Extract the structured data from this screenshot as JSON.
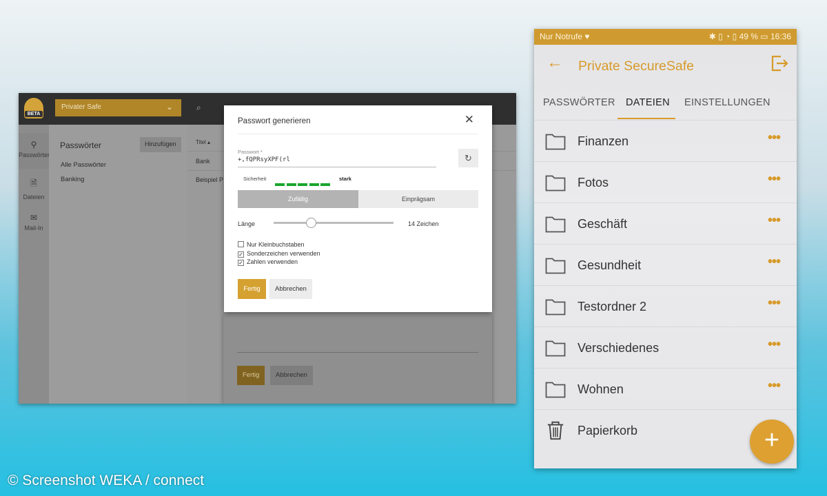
{
  "desktop": {
    "logo_text": "BETA",
    "safe_select": "Privater Safe",
    "rail": [
      {
        "label": "Passwörter",
        "icon": "key-icon"
      },
      {
        "label": "Dateien",
        "icon": "file-icon"
      },
      {
        "label": "Mail-In",
        "icon": "mail-icon"
      }
    ],
    "list": {
      "title": "Passwörter",
      "add_label": "Hinzufügen",
      "items": [
        "Alle Passwörter",
        "Banking"
      ]
    },
    "table": {
      "header": "Titel ▴",
      "rows": [
        "Bank",
        "Beispiel P"
      ]
    },
    "bg_dialog": {
      "ok_label": "Fertig",
      "cancel_label": "Abbrechen"
    }
  },
  "generator": {
    "title": "Passwort generieren",
    "password_label": "Passwort *",
    "password_value": "+,fQPRsyXPF(rl",
    "security_label": "Sicherheit",
    "security_value": "stark",
    "strength_segments_filled": 5,
    "modes": {
      "selected": "Zufällig",
      "other": "Einprägsam"
    },
    "length_label": "Länge",
    "length_value": "14 Zeichen",
    "length_fraction": 0.31,
    "options": [
      {
        "label": "Nur Kleinbuchstaben",
        "checked": false
      },
      {
        "label": "Sonderzeichen verwenden",
        "checked": true
      },
      {
        "label": "Zahlen verwenden",
        "checked": true
      }
    ],
    "ok_label": "Fertig",
    "cancel_label": "Abbrechen"
  },
  "phone": {
    "status_left": "Nur Notrufe ♥",
    "status_right": "✱ ▯ ◔ ▯ 49 % ▭ 16:36",
    "app_title": "Private SecureSafe",
    "tabs": [
      "PASSWÖRTER",
      "DATEIEN",
      "EINSTELLUNGEN"
    ],
    "active_tab": "DATEIEN",
    "folders": [
      "Finanzen",
      "Fotos",
      "Geschäft",
      "Gesundheit",
      "Testordner 2",
      "Verschiedenes",
      "Wohnen"
    ],
    "trash": "Papierkorb",
    "fab_label": "+",
    "accent": "#d79a2a"
  },
  "credit": "© Screenshot WEKA / connect"
}
